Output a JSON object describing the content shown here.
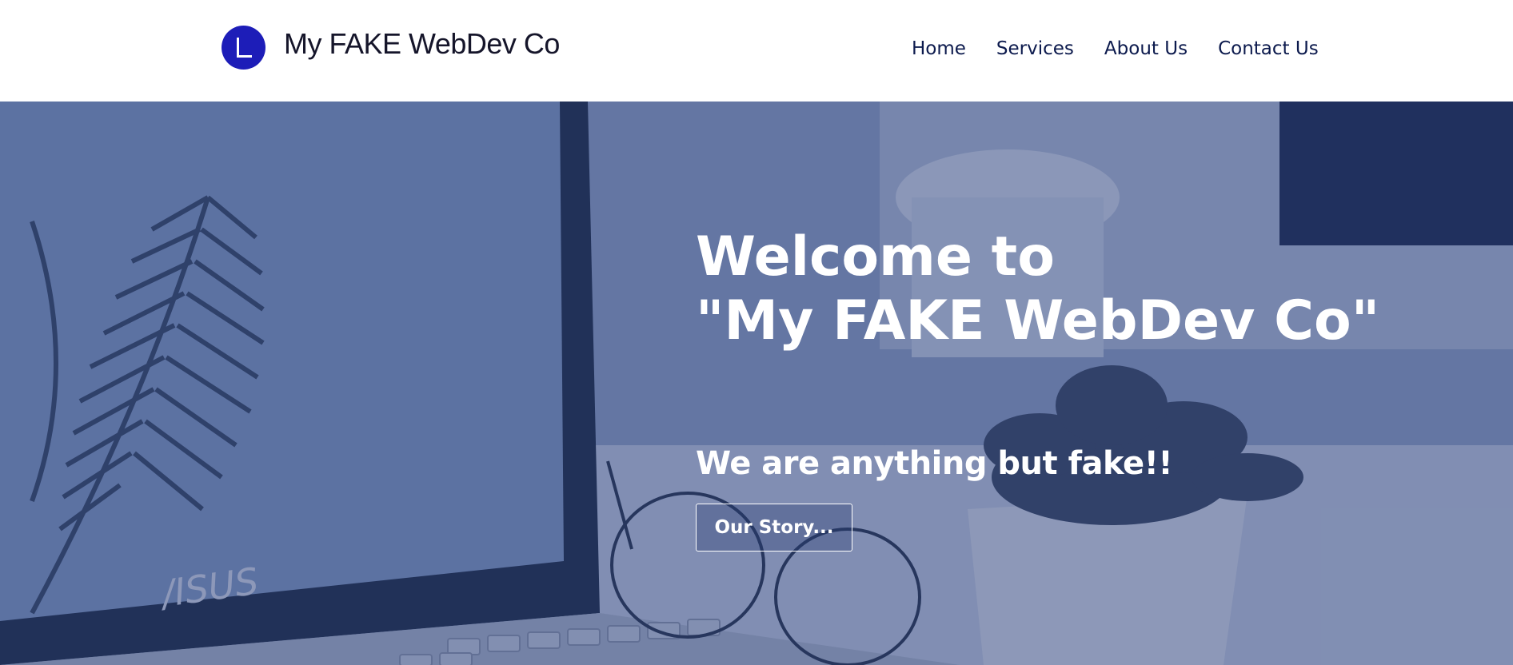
{
  "header": {
    "brand_name": "My FAKE WebDev Co",
    "logo_icon": "letter-l-logo-icon",
    "nav": [
      {
        "label": "Home"
      },
      {
        "label": "Services"
      },
      {
        "label": "About Us"
      },
      {
        "label": "Contact Us"
      }
    ]
  },
  "hero": {
    "title_line1": "Welcome to",
    "title_line2": "\"My FAKE WebDev Co\"",
    "tagline": "We are anything but fake!!",
    "cta_label": "Our Story...",
    "image_laptop_brand": "ASUS"
  },
  "colors": {
    "logo_blue": "#1d1db8",
    "nav_text": "#0c1a4d",
    "hero_overlay": "#1c3169",
    "hero_text": "#ffffff"
  }
}
